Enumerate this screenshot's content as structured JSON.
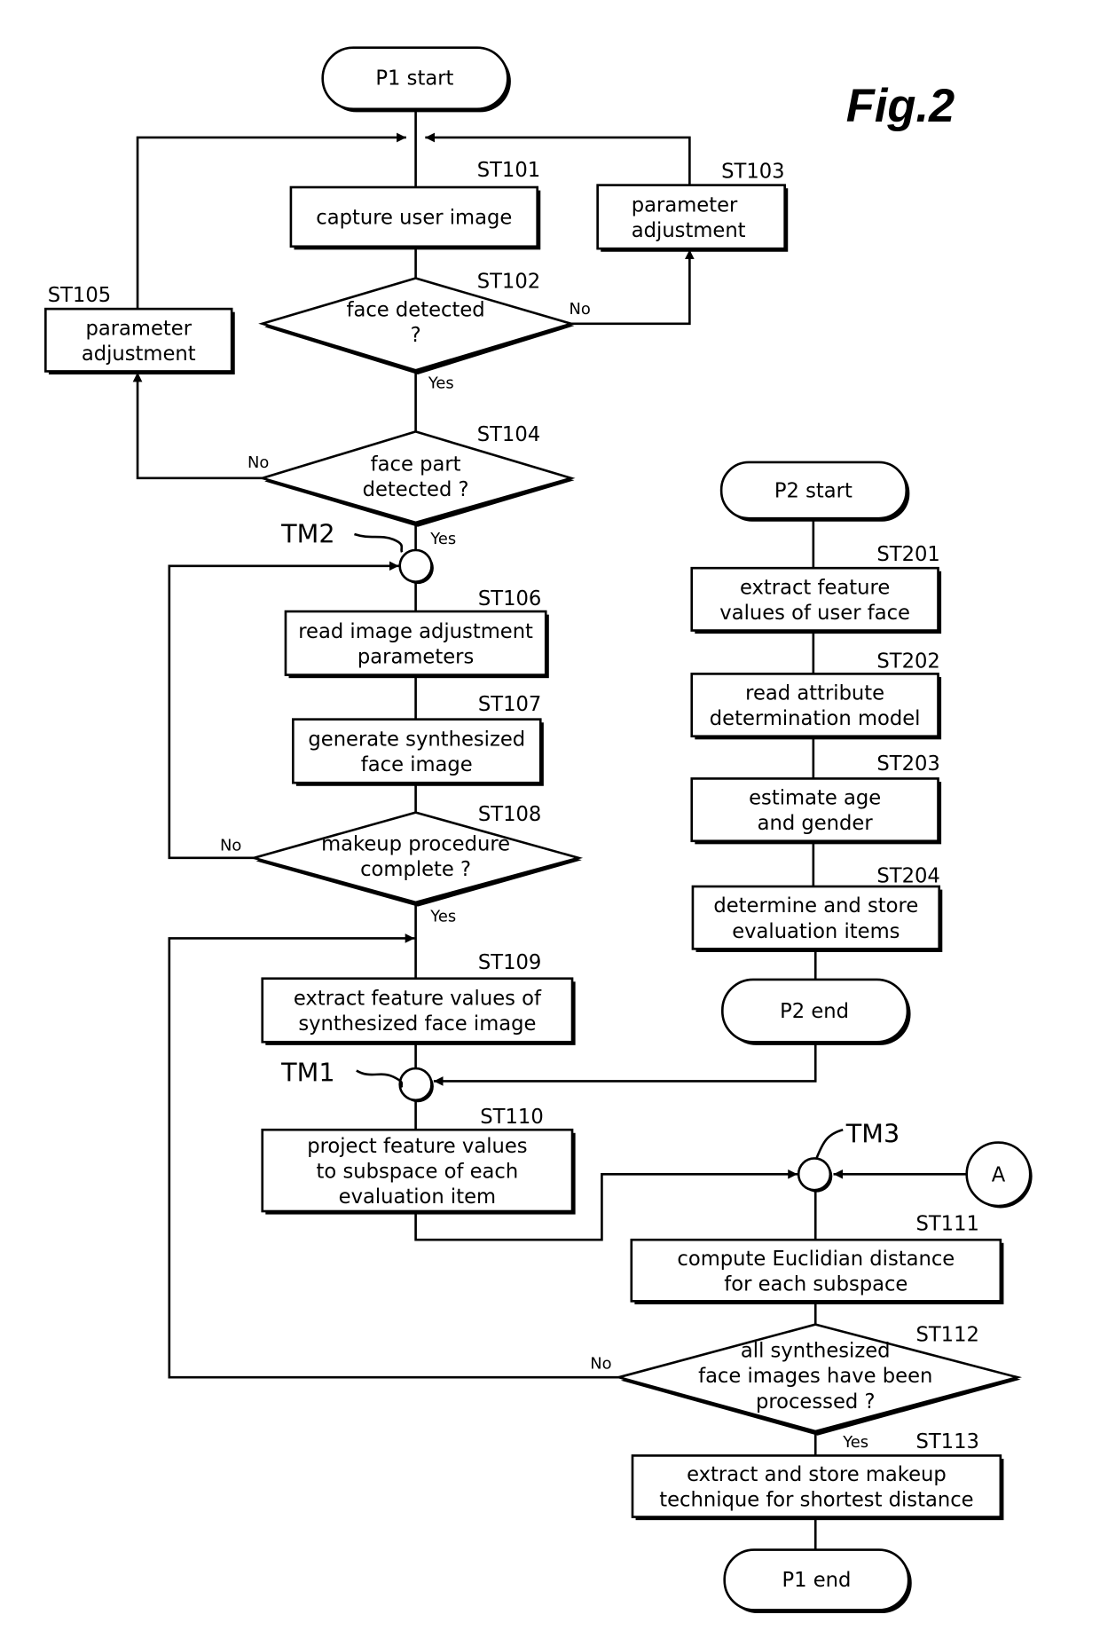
{
  "figure_title": "Fig.2",
  "terminals": {
    "p1_start": "P1 start",
    "p1_end": "P1 end",
    "p2_start": "P2 start",
    "p2_end": "P2 end"
  },
  "steps": {
    "ST101": {
      "id": "ST101",
      "lines": [
        "capture user image"
      ]
    },
    "ST102": {
      "id": "ST102",
      "lines": [
        "face detected",
        "?"
      ]
    },
    "ST103": {
      "id": "ST103",
      "lines": [
        "parameter",
        "adjustment"
      ]
    },
    "ST104": {
      "id": "ST104",
      "lines": [
        "face part",
        "detected ?"
      ]
    },
    "ST105": {
      "id": "ST105",
      "lines": [
        "parameter",
        "adjustment"
      ]
    },
    "ST106": {
      "id": "ST106",
      "lines": [
        "read image adjustment",
        "parameters"
      ]
    },
    "ST107": {
      "id": "ST107",
      "lines": [
        "generate synthesized",
        "face image"
      ]
    },
    "ST108": {
      "id": "ST108",
      "lines": [
        "makeup procedure",
        "complete ?"
      ]
    },
    "ST109": {
      "id": "ST109",
      "lines": [
        "extract feature values of",
        "synthesized face image"
      ]
    },
    "ST110": {
      "id": "ST110",
      "lines": [
        "project feature values",
        "to subspace of each",
        "evaluation item"
      ]
    },
    "ST111": {
      "id": "ST111",
      "lines": [
        "compute Euclidian distance",
        "for each subspace"
      ]
    },
    "ST112": {
      "id": "ST112",
      "lines": [
        "all synthesized",
        "face images have been",
        "processed ?"
      ]
    },
    "ST113": {
      "id": "ST113",
      "lines": [
        "extract and store makeup",
        "technique for shortest distance"
      ]
    },
    "ST201": {
      "id": "ST201",
      "lines": [
        "extract feature",
        "values of user face"
      ]
    },
    "ST202": {
      "id": "ST202",
      "lines": [
        "read attribute",
        "determination model"
      ]
    },
    "ST203": {
      "id": "ST203",
      "lines": [
        "estimate age",
        "and gender"
      ]
    },
    "ST204": {
      "id": "ST204",
      "lines": [
        "determine and store",
        "evaluation items"
      ]
    }
  },
  "branch_labels": {
    "yes": "Yes",
    "no": "No"
  },
  "junctions": {
    "tm1": "TM1",
    "tm2": "TM2",
    "tm3": "TM3",
    "connector_a": "A"
  }
}
